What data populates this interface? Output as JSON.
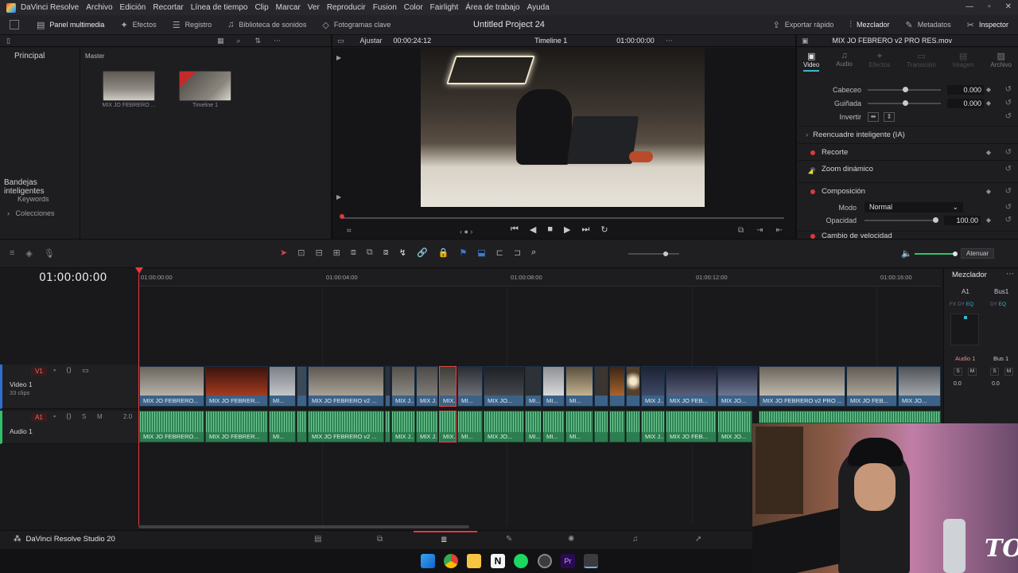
{
  "menubar": {
    "app": "DaVinci Resolve",
    "items": [
      "Archivo",
      "Edición",
      "Recortar",
      "Línea de tiempo",
      "Clip",
      "Marcar",
      "Ver",
      "Reproducir",
      "Fusion",
      "Color",
      "Fairlight",
      "Área de trabajo",
      "Ayuda"
    ]
  },
  "toolbar": {
    "left": [
      "Panel multimedia",
      "Efectos",
      "Registro",
      "Biblioteca de sonidos",
      "Fotogramas clave"
    ],
    "project_title": "Untitled Project 24",
    "right": [
      "Exportar rápido",
      "Mezclador",
      "Metadatos",
      "Inspector"
    ]
  },
  "viewer": {
    "fit": "Ajustar",
    "timecode": "00:00:24:12",
    "timeline_name": "Timeline 1",
    "timeline_tc": "01:00:00:00",
    "clip_name": "MIX JO FEBRERO v2 PRO RES.mov"
  },
  "media": {
    "tab_main": "Principal",
    "tab_master": "Master",
    "smart_bins": "Bandejas inteligentes",
    "keywords": "Keywords",
    "collections": "Colecciones",
    "items": [
      {
        "caption": "MIX JO FEBRERO ..."
      },
      {
        "caption": "Timeline 1"
      }
    ]
  },
  "inspector": {
    "tabs": [
      "Video",
      "Audio",
      "Efectos",
      "Transición",
      "Imagen",
      "Archivo"
    ],
    "params": [
      {
        "label": "Cabeceo",
        "value": "0.000"
      },
      {
        "label": "Guiñada",
        "value": "0.000"
      }
    ],
    "invert_label": "Invertir",
    "smart_reframe": "Reencuadre inteligente (IA)",
    "crop": "Recorte",
    "dynamic_zoom": "Zoom dinámico",
    "composite": "Composición",
    "mode_label": "Modo",
    "mode_value": "Normal",
    "opacity_label": "Opacidad",
    "opacity_value": "100.00",
    "speed": "Cambio de velocidad"
  },
  "timeline": {
    "timecode": "01:00:00:00",
    "ruler": [
      "01:00:00:00",
      "01:00:04:00",
      "01:00:08:00",
      "01:00:12:00",
      "01:00:16:00"
    ],
    "video_track": {
      "badge": "V1",
      "name": "Video 1",
      "clips": "33 clips"
    },
    "audio_track": {
      "badge": "A1",
      "name": "Audio 1",
      "level": "2.0"
    },
    "dim_label": "Atenuar",
    "clip_labels": [
      "MIX JO FEBRERO...",
      "MIX JO FEBRER...",
      "MI...",
      "MIX JO FEBRERO v2 ...",
      "MIX J...",
      "MIX J...",
      "MIX...",
      "MI...",
      "MIX JO...",
      "MI...",
      "MI...",
      "MI...",
      "MIX J...",
      "MIX JO FEB...",
      "MIX JO...",
      "MIX JO FEBRERO v2 PRO ...",
      "MIX JO FEB...",
      "MIX JO..."
    ]
  },
  "mixer": {
    "title": "Mezclador",
    "channels": [
      "A1",
      "Bus1"
    ],
    "strip_labels": [
      "Audio 1",
      "Bus 1"
    ],
    "readouts": [
      "0.0",
      "0.0"
    ]
  },
  "bottom": {
    "brand": "DaVinci Resolve Studio 20"
  },
  "colors": {
    "accent_red": "#d93b3b",
    "video_clip": "#2c4d6e",
    "audio_clip": "#2c7d4f",
    "teal": "#3ab7c7"
  }
}
